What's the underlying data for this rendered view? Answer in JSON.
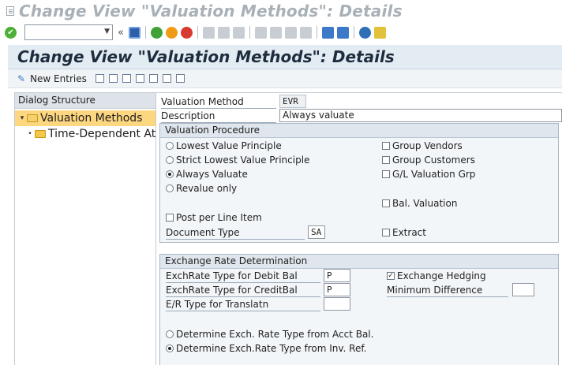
{
  "window": {
    "title": "Change View \"Valuation Methods\": Details"
  },
  "toolbar": {
    "command_value": ""
  },
  "app": {
    "title": "Change View \"Valuation Methods\": Details",
    "new_entries_label": "New Entries"
  },
  "dialog_structure": {
    "header": "Dialog Structure",
    "items": [
      {
        "label": "Valuation Methods",
        "selected": true
      },
      {
        "label": "Time-Dependent Att"
      }
    ]
  },
  "form": {
    "valuation_method_label": "Valuation Method",
    "valuation_method_value": "EVR",
    "description_label": "Description",
    "description_value": "Always valuate",
    "valuation_procedure": {
      "header": "Valuation Procedure",
      "radios": [
        {
          "label": "Lowest Value Principle",
          "checked": false
        },
        {
          "label": "Strict Lowest Value Principle",
          "checked": false
        },
        {
          "label": "Always Valuate",
          "checked": true
        },
        {
          "label": "Revalue only",
          "checked": false
        }
      ],
      "checks": [
        {
          "label": "Group Vendors",
          "checked": false
        },
        {
          "label": "Group Customers",
          "checked": false
        },
        {
          "label": "G/L Valuation Grp",
          "checked": false
        },
        {
          "label": "Bal. Valuation",
          "checked": false
        },
        {
          "label": "Post per Line Item",
          "checked": false
        },
        {
          "label": "Extract",
          "checked": false
        }
      ],
      "document_type_label": "Document Type",
      "document_type_value": "SA"
    },
    "exchange_rate": {
      "header": "Exchange Rate Determination",
      "debit_label": "ExchRate Type for Debit Bal",
      "debit_value": "P",
      "credit_label": "ExchRate Type for CreditBal",
      "credit_value": "P",
      "translatn_label": "E/R Type for Translatn",
      "translatn_value": "",
      "hedging_label": "Exchange Hedging",
      "hedging_checked": true,
      "min_diff_label": "Minimum Difference",
      "min_diff_value": "",
      "radios": [
        {
          "label": "Determine Exch. Rate Type from Acct Bal.",
          "checked": false
        },
        {
          "label": "Determine Exch.Rate Type from Inv. Ref.",
          "checked": true
        }
      ]
    }
  }
}
